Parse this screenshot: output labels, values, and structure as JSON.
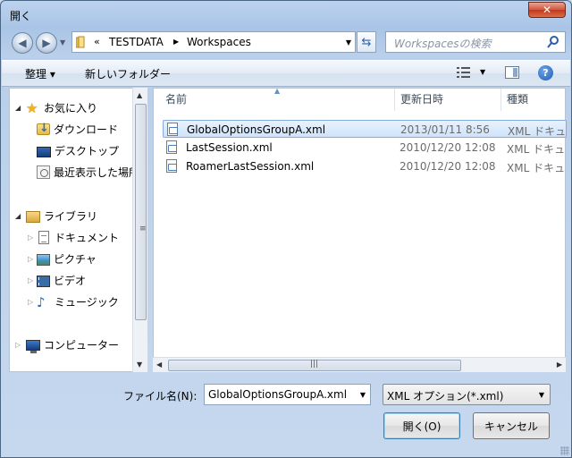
{
  "window": {
    "title": "開く",
    "close_label": "✕"
  },
  "address": {
    "overflow_glyph": "«",
    "segments": [
      "TESTDATA",
      "Workspaces"
    ]
  },
  "search": {
    "placeholder": "Workspacesの検索"
  },
  "toolbar": {
    "organize_label": "整理 ▾",
    "new_folder_label": "新しいフォルダー",
    "help_label": "?"
  },
  "sidebar": {
    "favorites": {
      "label": "お気に入り",
      "items": [
        "ダウンロード",
        "デスクトップ",
        "最近表示した場所"
      ]
    },
    "libraries": {
      "label": "ライブラリ",
      "items": [
        "ドキュメント",
        "ピクチャ",
        "ビデオ",
        "ミュージック"
      ]
    },
    "computer": {
      "label": "コンピューター"
    }
  },
  "columns": {
    "name": "名前",
    "modified": "更新日時",
    "type": "種類"
  },
  "files": [
    {
      "name": "GlobalOptionsGroupA.xml",
      "modified": "2013/01/11 8:56",
      "type": "XML ドキュメント",
      "selected": true
    },
    {
      "name": "LastSession.xml",
      "modified": "2010/12/20 12:08",
      "type": "XML ドキュメント",
      "selected": false
    },
    {
      "name": "RoamerLastSession.xml",
      "modified": "2010/12/20 12:08",
      "type": "XML ドキュメント",
      "selected": false
    }
  ],
  "filename": {
    "label": "ファイル名(N):",
    "value": "GlobalOptionsGroupA.xml"
  },
  "filetype": {
    "value": "XML オプション(*.xml)"
  },
  "buttons": {
    "open": "開く(O)",
    "cancel": "キャンセル"
  }
}
